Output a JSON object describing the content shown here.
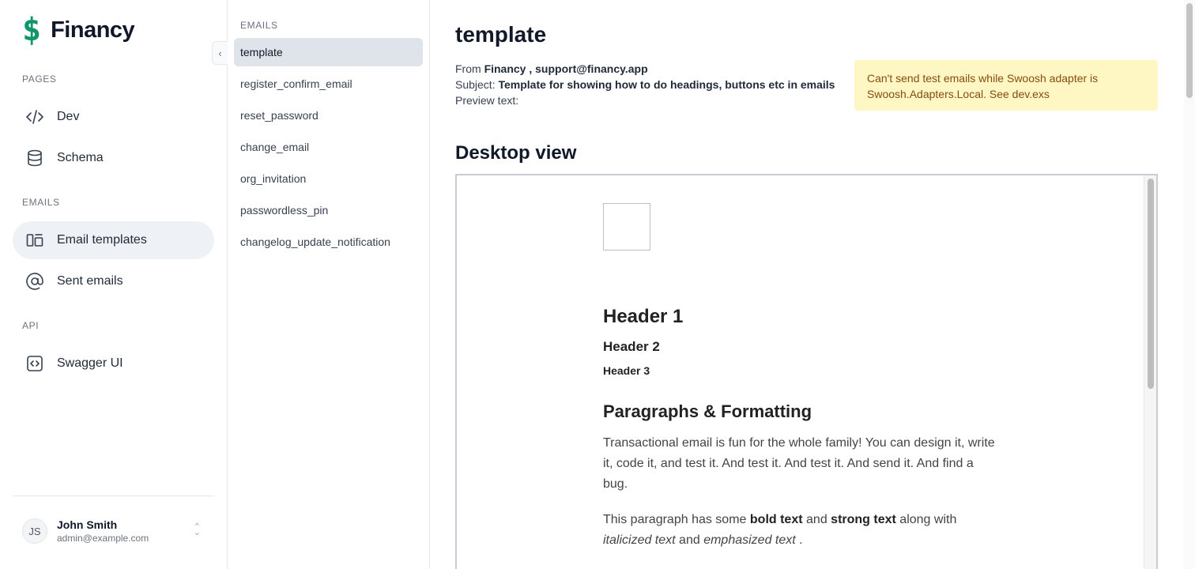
{
  "brand": {
    "logo_glyph": "$",
    "name": "Financy",
    "accent": "#10946a"
  },
  "sidebar": {
    "collapse_glyph": "‹",
    "sections": [
      {
        "label": "PAGES"
      },
      {
        "label": "EMAILS"
      },
      {
        "label": "API"
      }
    ],
    "items": [
      {
        "label": "Dev",
        "icon": "code-icon"
      },
      {
        "label": "Schema",
        "icon": "database-icon"
      },
      {
        "label": "Email templates",
        "icon": "templates-icon",
        "active": true
      },
      {
        "label": "Sent emails",
        "icon": "at-sign-icon"
      },
      {
        "label": "Swagger UI",
        "icon": "code-square-icon"
      }
    ],
    "user": {
      "initials": "JS",
      "name": "John Smith",
      "email": "admin@example.com",
      "chevron": "⌃⌄"
    }
  },
  "email_list": {
    "label": "EMAILS",
    "items": [
      {
        "label": "template",
        "active": true
      },
      {
        "label": "register_confirm_email"
      },
      {
        "label": "reset_password"
      },
      {
        "label": "change_email"
      },
      {
        "label": "org_invitation"
      },
      {
        "label": "passwordless_pin"
      },
      {
        "label": "changelog_update_notification"
      }
    ]
  },
  "main": {
    "title": "template",
    "from_label": "From",
    "from_value": "Financy , support@financy.app",
    "subject_label": "Subject:",
    "subject_value": "Template for showing how to do headings, buttons etc in emails",
    "preview_label": "Preview text:",
    "alert_text": "Can't send test emails while Swoosh adapter is Swoosh.Adapters.Local. See dev.exs",
    "view_title": "Desktop view",
    "preview": {
      "h1": "Header 1",
      "h2": "Header 2",
      "h3": "Header 3",
      "section_title": "Paragraphs & Formatting",
      "para1": "Transactional email is fun for the whole family! You can design it, write it, code it, and test it. And test it. And test it. And send it. And find a bug.",
      "para2_a": "This paragraph has some",
      "para2_bold": "bold text",
      "para2_and": "and",
      "para2_strong": "strong text",
      "para2_with": "along with",
      "para2_italic": "italicized text",
      "para2_and2": "and",
      "para2_em": "emphasized text",
      "para2_end": "."
    }
  }
}
